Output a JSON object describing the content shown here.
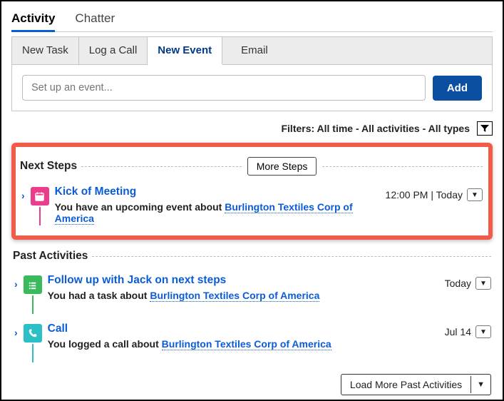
{
  "top_tabs": {
    "activity": "Activity",
    "chatter": "Chatter"
  },
  "subtabs": {
    "new_task": "New Task",
    "log_call": "Log a Call",
    "new_event": "New Event",
    "email": "Email"
  },
  "composer": {
    "placeholder": "Set up an event...",
    "add": "Add"
  },
  "filters": {
    "label": "Filters: All time - All activities - All types"
  },
  "next_steps": {
    "title": "Next Steps",
    "more_btn": "More Steps",
    "item": {
      "title": "Kick of Meeting",
      "sub_prefix": "You have an upcoming event about ",
      "link": "Burlington Textiles Corp of America",
      "time": "12:00 PM | Today"
    }
  },
  "past": {
    "title": "Past Activities",
    "items": [
      {
        "title": "Follow up with Jack on next steps",
        "sub_prefix": "You had a task about ",
        "link": "Burlington Textiles Corp of America",
        "date": "Today",
        "icon": "task"
      },
      {
        "title": "Call",
        "sub_prefix": "You logged a call about ",
        "link": "Burlington Textiles Corp of America",
        "date": "Jul 14",
        "icon": "call"
      }
    ],
    "load_more": "Load More Past Activities"
  }
}
